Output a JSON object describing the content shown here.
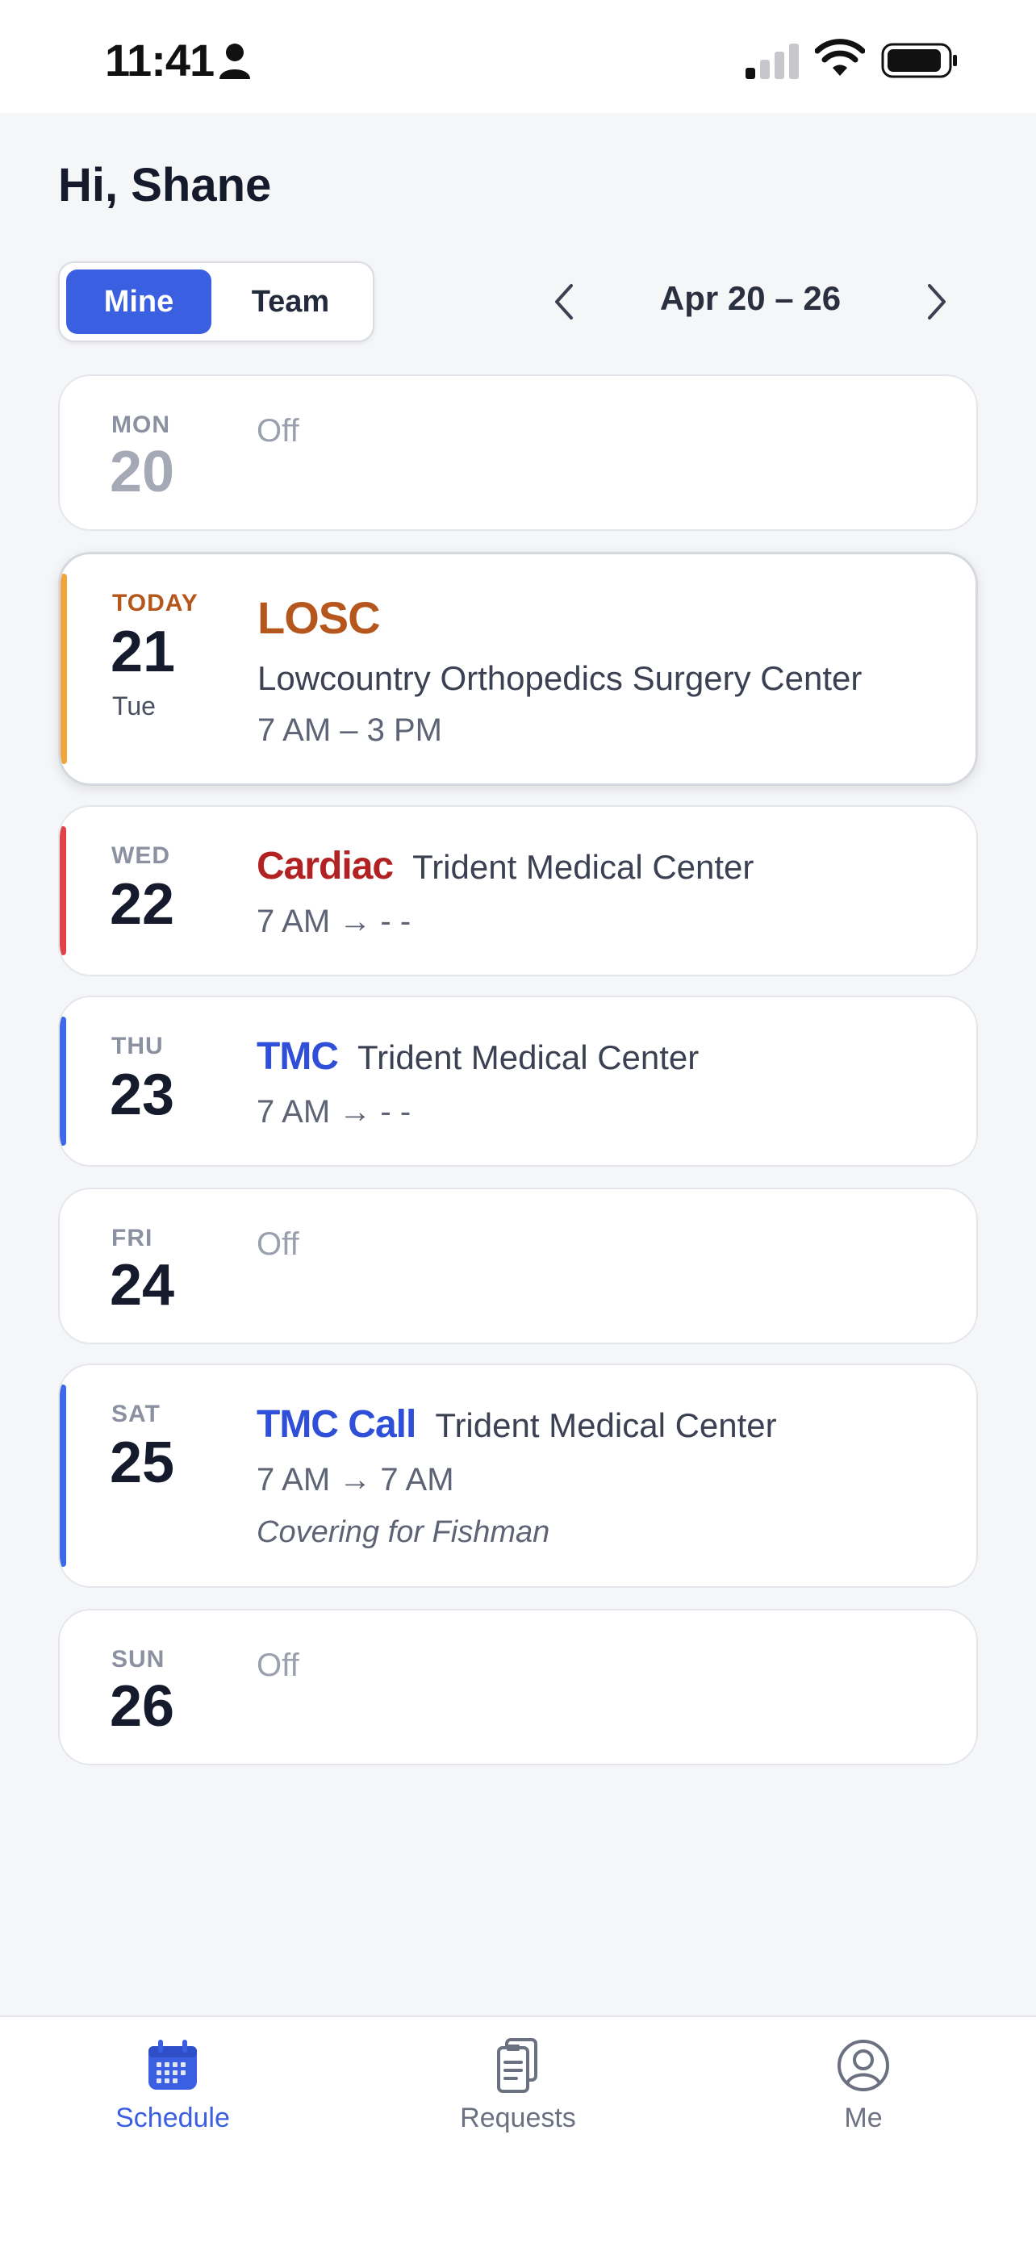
{
  "status": {
    "time": "11:41"
  },
  "greeting": "Hi, Shane",
  "segments": {
    "mine": "Mine",
    "team": "Team",
    "selected": "Mine"
  },
  "week": {
    "label": "Apr 20 – 26"
  },
  "days": [
    {
      "dow": "MON",
      "num": "20",
      "off": "Off"
    },
    {
      "dow": "TODAY",
      "num": "21",
      "sub": "Tue",
      "code": "LOSC",
      "location": "Lowcountry Orthopedics Surgery Center",
      "time": "7 AM – 3 PM",
      "accent": "#f0a43a",
      "code_color": "#b5561c"
    },
    {
      "dow": "WED",
      "num": "22",
      "code": "Cardiac",
      "location": "Trident Medical Center",
      "time": "7 AM → - -",
      "accent": "#e0424a",
      "code_color": "#b22222"
    },
    {
      "dow": "THU",
      "num": "23",
      "code": "TMC",
      "location": "Trident Medical Center",
      "time": "7 AM → - -",
      "accent": "#3a6ae8",
      "code_color": "#2f4fd8"
    },
    {
      "dow": "FRI",
      "num": "24",
      "off": "Off"
    },
    {
      "dow": "SAT",
      "num": "25",
      "code": "TMC Call",
      "location": "Trident Medical Center",
      "time": "7 AM → 7 AM",
      "note": "Covering for Fishman",
      "accent": "#3a6ae8",
      "code_color": "#2f4fd8"
    },
    {
      "dow": "SUN",
      "num": "26",
      "off": "Off"
    }
  ],
  "tabs": [
    {
      "label": "Schedule",
      "icon": "calendar-icon",
      "active": true
    },
    {
      "label": "Requests",
      "icon": "clipboard-icon",
      "active": false
    },
    {
      "label": "Me",
      "icon": "user-circle-icon",
      "active": false
    }
  ],
  "colors": {
    "accent": "#3a5fe0",
    "background": "#f5f6f8"
  }
}
